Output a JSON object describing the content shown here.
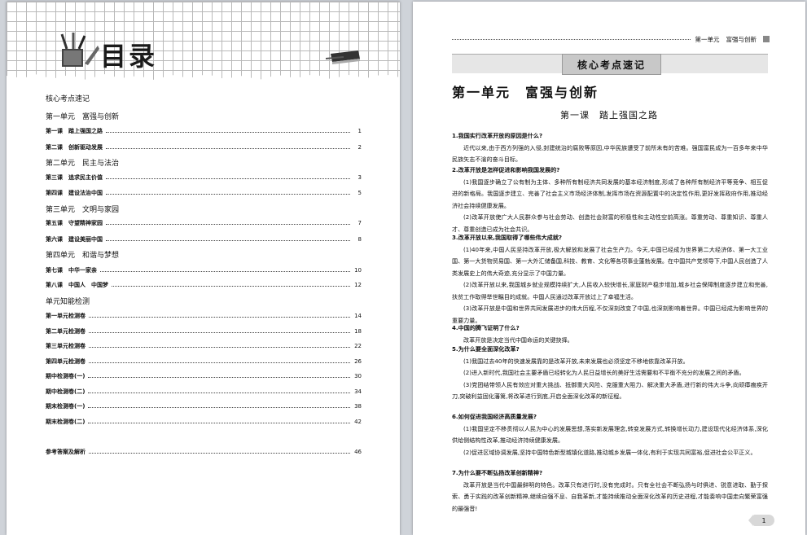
{
  "left_page": {
    "title": "目录",
    "toc": {
      "core_heading": "核心考点速记",
      "sections": [
        {
          "unit": "第一单元　富强与创新",
          "lessons": [
            {
              "label": "第一课　踏上强国之路",
              "page": "1"
            },
            {
              "label": "第二课　创新驱动发展",
              "page": "2"
            }
          ]
        },
        {
          "unit": "第二单元　民主与法治",
          "lessons": [
            {
              "label": "第三课　追求民主价值",
              "page": "3"
            },
            {
              "label": "第四课　建设法治中国",
              "page": "5"
            }
          ]
        },
        {
          "unit": "第三单元　文明与家园",
          "lessons": [
            {
              "label": "第五课　守望精神家园",
              "page": "7"
            },
            {
              "label": "第六课　建设美丽中国",
              "page": "8"
            }
          ]
        },
        {
          "unit": "第四单元　和谐与梦想",
          "lessons": [
            {
              "label": "第七课　中华一家亲",
              "page": "10"
            },
            {
              "label": "第八课　中国人　中国梦",
              "page": "12"
            }
          ]
        }
      ],
      "tests_heading": "单元知能检测",
      "tests": [
        {
          "label": "第一单元检测卷",
          "page": "14"
        },
        {
          "label": "第二单元检测卷",
          "page": "18"
        },
        {
          "label": "第三单元检测卷",
          "page": "22"
        },
        {
          "label": "第四单元检测卷",
          "page": "26"
        },
        {
          "label": "期中检测卷(一)",
          "page": "30"
        },
        {
          "label": "期中检测卷(二)",
          "page": "34"
        },
        {
          "label": "期末检测卷(一)",
          "page": "38"
        },
        {
          "label": "期末检测卷(二)",
          "page": "42"
        }
      ],
      "answers": {
        "label": "参考答案及解析",
        "page": "46"
      }
    }
  },
  "right_page": {
    "running_head": {
      "unit": "第一单元",
      "subtitle": "富强与创新"
    },
    "banner": "核心考点速记",
    "unit_title": "第一单元　富强与创新",
    "lesson_title": "第一课　踏上强国之路",
    "qa": [
      {
        "q": "1.我国实行改革开放的原因是什么?",
        "a": [
          "近代以来,由于西方列强的入侵,封建统治的腐败等原因,中华民族遭受了前所未有的苦难。强国富民成为一百多年来中华民族矢志不渝的奋斗目标。"
        ]
      },
      {
        "q": "2.改革开放是怎样促进和影响我国发展的?",
        "a": [
          "(1)我国逐步确立了公有制为主体、多种所有制经济共同发展的基本经济制度,形成了各种所有制经济平等竞争、相互促进的新格局。我国逐步建立、完善了社会主义市场经济体制,发挥市场在资源配置中的决定性作用,更好发挥政府作用,推动经济社会持续健康发展。",
          "(2)改革开放使广大人民群众参与社会劳动、创造社会财富的积极性和主动性空前高涨。尊重劳动、尊重知识、尊重人才、尊重创造已成为社会共识。"
        ]
      },
      {
        "q": "3.改革开放以来,我国取得了哪些伟大成就?",
        "a": [
          "(1)40年来,中国人民坚持改革开放,极大解放和发展了社会生产力。今天,中国已经成为世界第二大经济体、第一大工业国、第一大货物贸易国、第一大外汇储备国,科技、教育、文化等各项事业蓬勃发展。在中国共产党领导下,中国人民创造了人类发展史上的伟大奇迹,充分显示了中国力量。",
          "(2)改革开放以来,我国城乡就业规模持续扩大,人民收入较快增长,家庭财产稳步增加,城乡社会保障制度逐步建立和完善,扶贫工作取得举世瞩目的成就。中国人民通过改革开放过上了幸福生活。",
          "(3)改革开放是中国和世界共同发展进步的伟大历程,不仅深刻改变了中国,也深刻影响着世界。中国已经成为影响世界的重要力量。"
        ]
      },
      {
        "q": "4.中国的腾飞证明了什么?",
        "a": [
          "改革开放是决定当代中国命运的关键抉择。"
        ]
      },
      {
        "q": "5.为什么要全面深化改革?",
        "a": [
          "(1)我国过去40年的快速发展靠的是改革开放,未来发展也必须坚定不移地依靠改革开放。",
          "(2)进入新时代,我国社会主要矛盾已经转化为人民日益增长的美好生活需要和不平衡不充分的发展之间的矛盾。",
          "(3)党团结带领人民有效应对重大挑战、抵御重大风险、克服重大阻力、解决重大矛盾,进行新的伟大斗争,向顽瘴痼疾开刀,突破利益固化藩篱,将改革进行到底,开启全面深化改革的新征程。"
        ]
      },
      {
        "q": "6.如何促进我国经济高质量发展?",
        "a": [
          "(1)我国坚定不移贯彻以人民为中心的发展思想,落实新发展理念,转变发展方式,转换增长动力,建设现代化经济体系,深化供给侧结构性改革,推动经济持续健康发展。",
          "(2)促进区域协调发展,坚持中国特色新型城镇化道路,推动城乡发展一体化,有利于实现共同富裕,促进社会公平正义。"
        ]
      },
      {
        "q": "7.为什么要不断弘扬改革创新精神?",
        "a": [
          "改革开放是当代中国最鲜明的特色。改革只有进行时,没有完成时。只有全社会不断弘扬与时俱进、锐意进取、勤于探索、勇于实践的改革创新精神,继续自强不息、自我革新,才能持续推动全面深化改革的历史进程,才能奏响中国走向繁荣富强的最强音!"
        ]
      }
    ],
    "page_number": "1"
  }
}
